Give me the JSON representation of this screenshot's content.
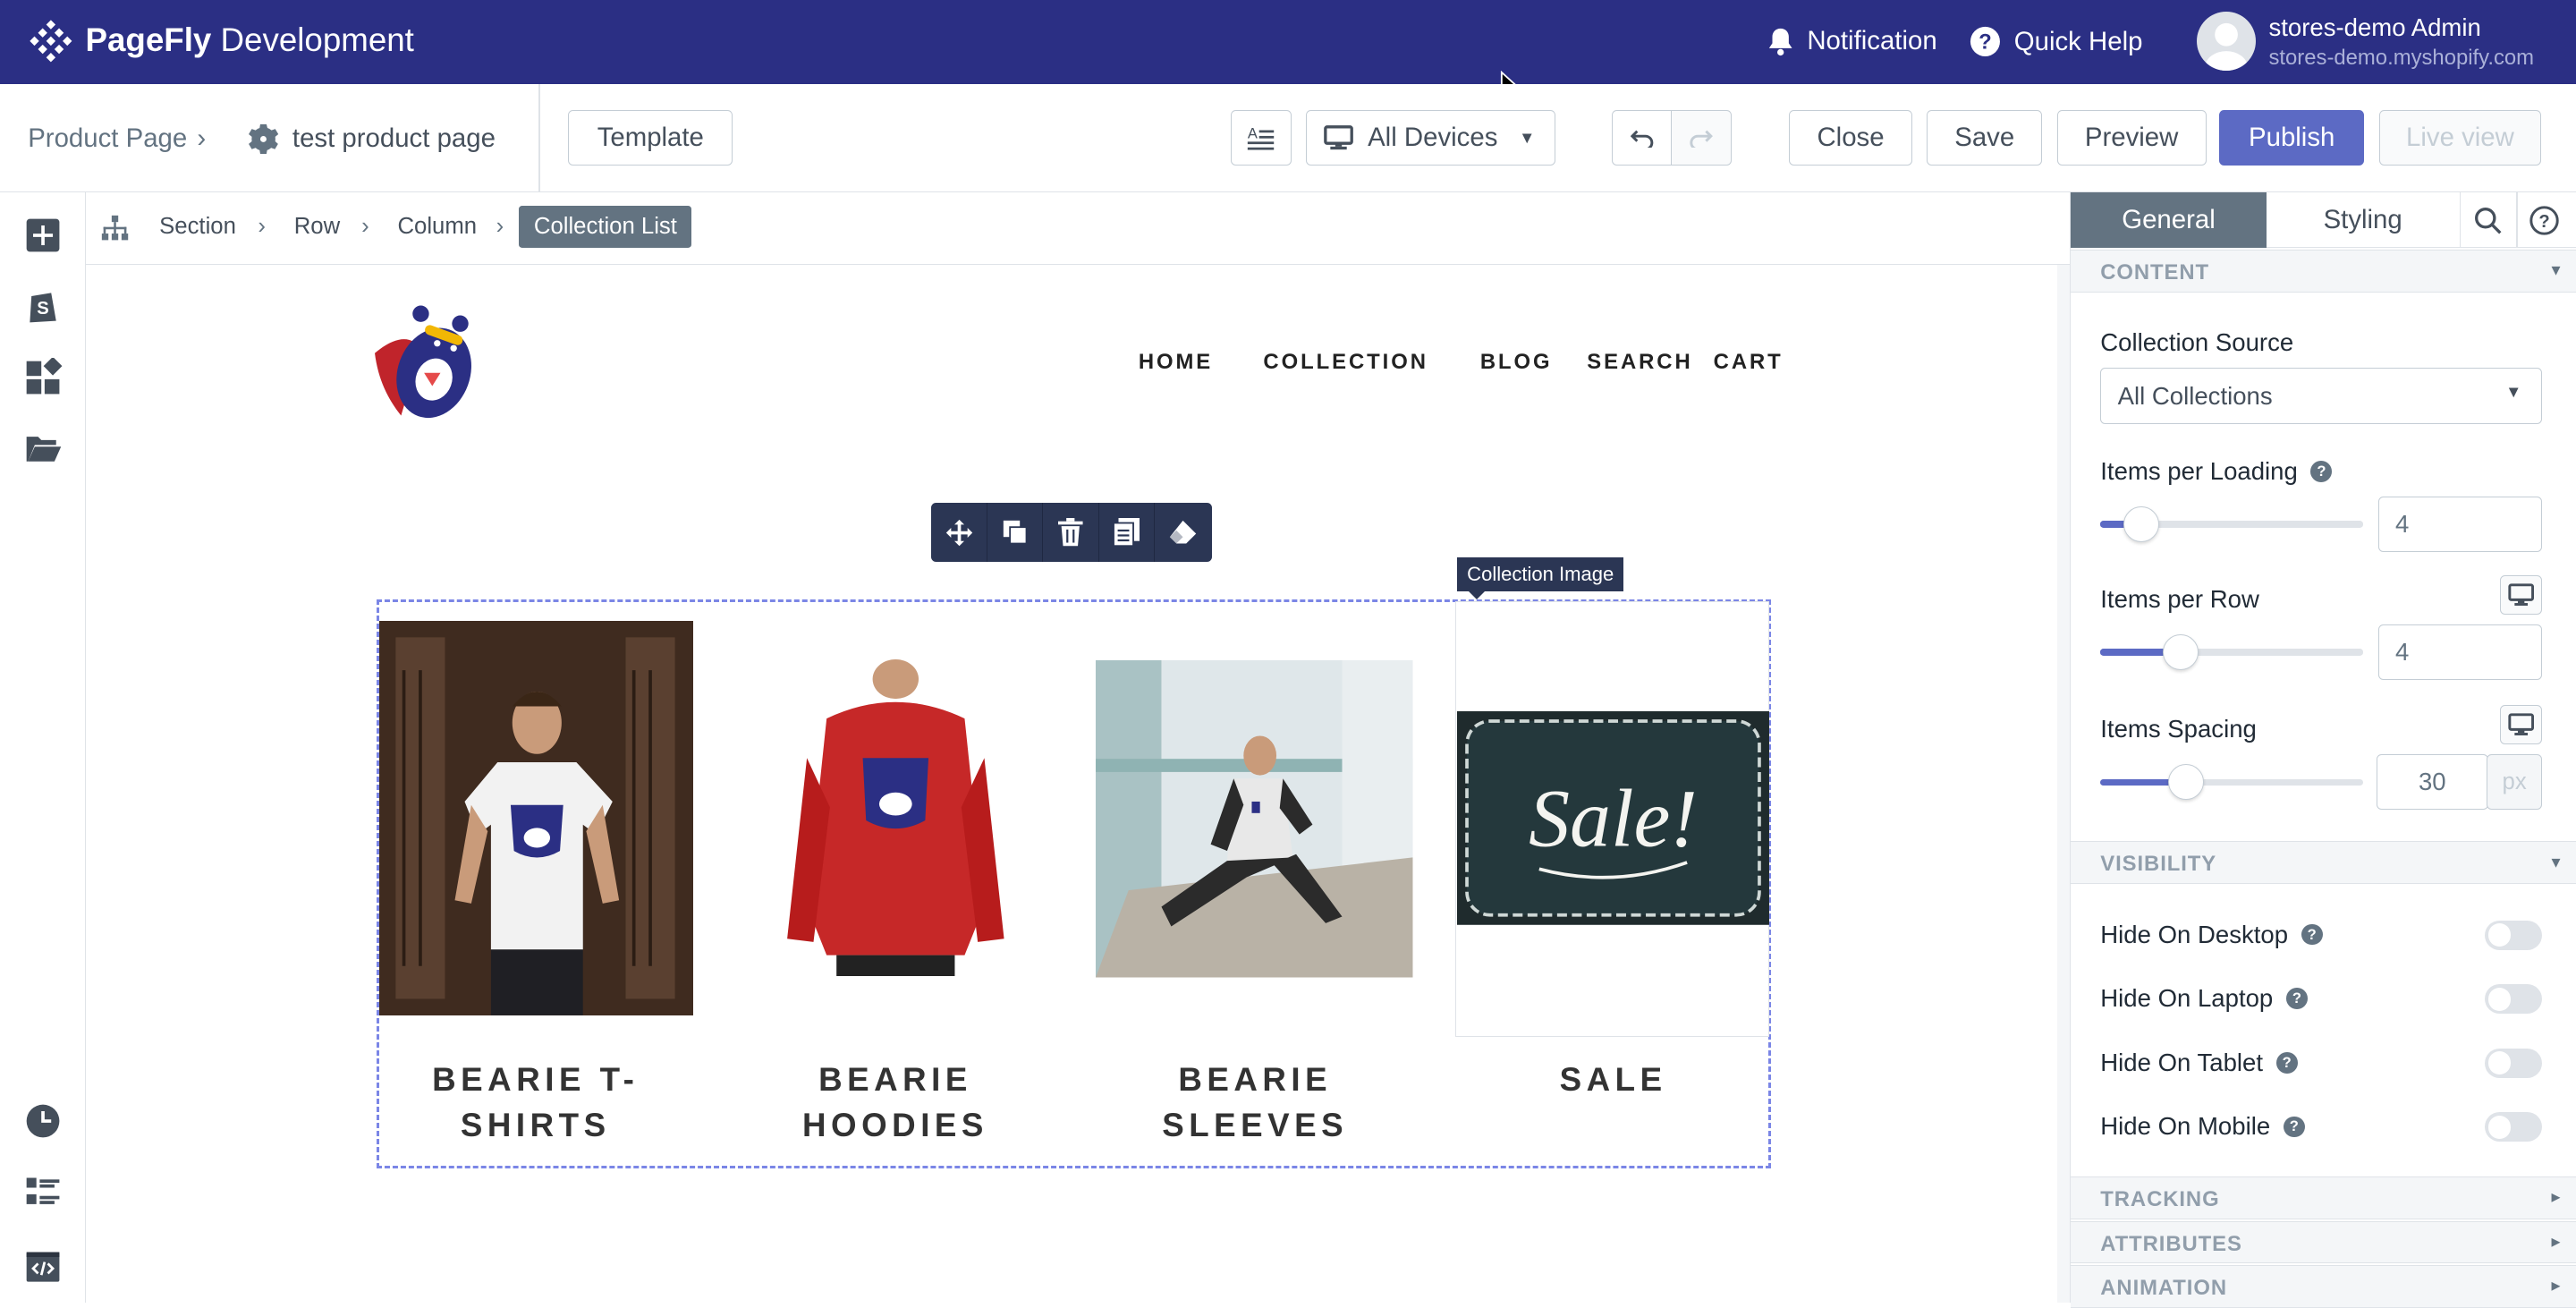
{
  "topbar": {
    "brand_bold": "PageFly",
    "brand_rest": " Development",
    "notification_label": "Notification",
    "quick_help_label": "Quick Help",
    "user_name": "stores-demo Admin",
    "user_store": "stores-demo.myshopify.com"
  },
  "toolbar": {
    "breadcrumb_root": "Product Page",
    "page_name": "test product page",
    "template_label": "Template",
    "device_label": "All Devices",
    "close_label": "Close",
    "save_label": "Save",
    "preview_label": "Preview",
    "publish_label": "Publish",
    "live_view_label": "Live view"
  },
  "element_breadcrumb": [
    "Section",
    "Row",
    "Column",
    "Collection List"
  ],
  "store": {
    "nav": [
      "HOME",
      "COLLECTION",
      "BLOG",
      "SEARCH",
      "CART"
    ],
    "collection_image_tag": "Collection Image",
    "collections": [
      {
        "title_line1": "BEARIE T-",
        "title_line2": "SHIRTS"
      },
      {
        "title_line1": "BEARIE",
        "title_line2": "HOODIES"
      },
      {
        "title_line1": "BEARIE",
        "title_line2": "SLEEVES"
      },
      {
        "title_line1": "SALE",
        "title_line2": ""
      }
    ],
    "sale_sign_text": "Sale!"
  },
  "panel": {
    "tabs": {
      "general": "General",
      "styling": "Styling"
    },
    "content_heading": "CONTENT",
    "collection_source_label": "Collection Source",
    "collection_source_value": "All Collections",
    "items_per_loading_label": "Items per Loading",
    "items_per_loading_value": "4",
    "items_per_row_label": "Items per Row",
    "items_per_row_value": "4",
    "items_spacing_label": "Items Spacing",
    "items_spacing_value": "30",
    "items_spacing_unit": "px",
    "visibility_heading": "VISIBILITY",
    "hide_desktop": "Hide On Desktop",
    "hide_laptop": "Hide On Laptop",
    "hide_tablet": "Hide On Tablet",
    "hide_mobile": "Hide On Mobile",
    "tracking_heading": "TRACKING",
    "attributes_heading": "ATTRIBUTES",
    "animation_heading": "ANIMATION",
    "help_glyph": "?"
  },
  "colors": {
    "topbar_bg": "#2b2f84",
    "accent": "#5c6ac4",
    "element_toolbar_bg": "#2b3654",
    "selection_border": "#7b86e6"
  }
}
